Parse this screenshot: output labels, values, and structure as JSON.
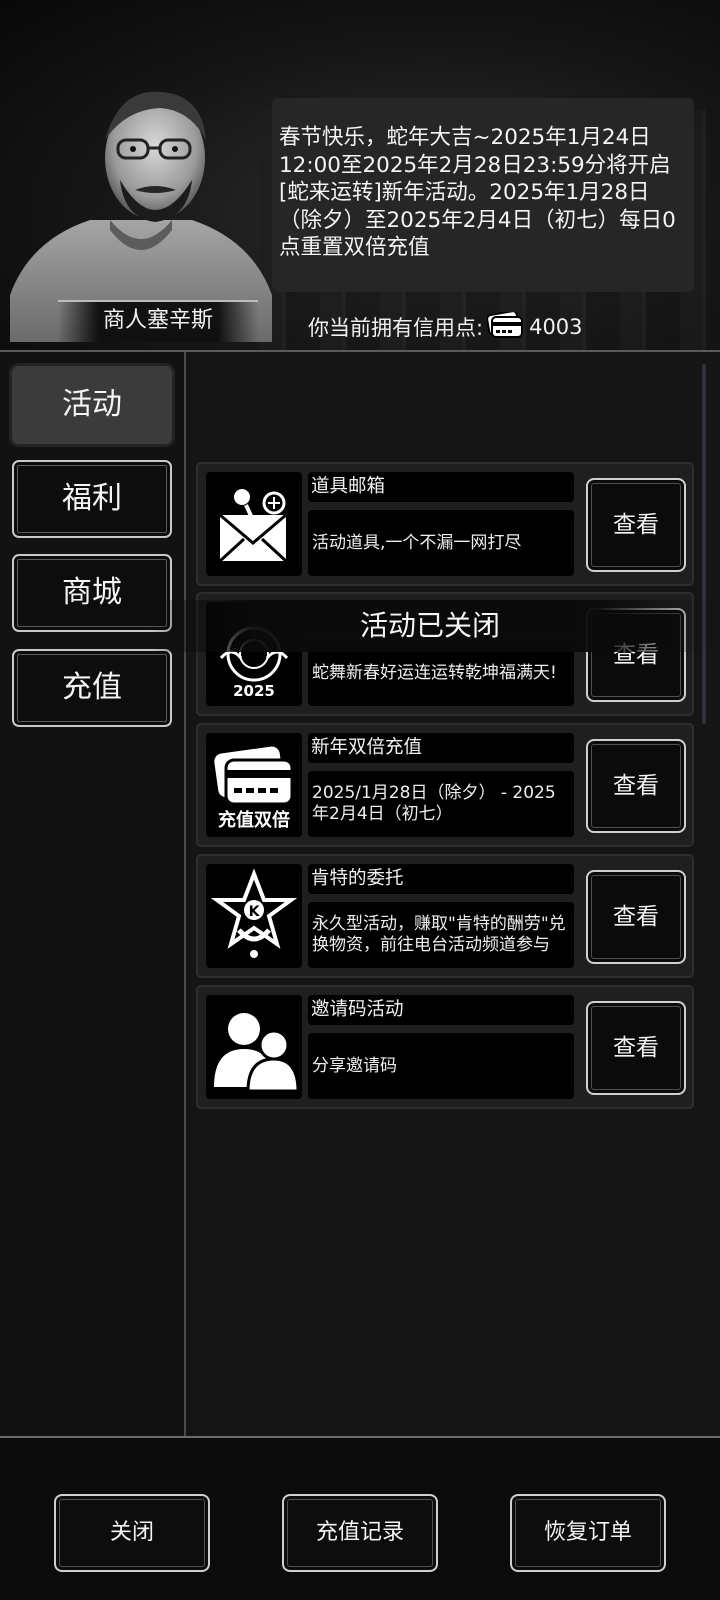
{
  "npc": {
    "name": "商人塞辛斯",
    "message": "春节快乐，蛇年大吉~2025年1月24日12:00至2025年2月28日23:59分将开启[蛇来运转]新年活动。2025年1月28日（除夕）至2025年2月4日（初七）每日0点重置双倍充值"
  },
  "credit": {
    "label": "你当前拥有信用点:",
    "value": "4003"
  },
  "sidebar": {
    "tabs": [
      {
        "label": "活动",
        "active": true
      },
      {
        "label": "福利",
        "active": false
      },
      {
        "label": "商城",
        "active": false
      },
      {
        "label": "充值",
        "active": false
      }
    ]
  },
  "activities": [
    {
      "title": "道具邮箱",
      "desc": "活动道具,一个不漏一网打尽",
      "icon": "mail-pin-icon",
      "button": "查看"
    },
    {
      "title": "",
      "desc": "蛇舞新春好运连运转乾坤福满天!",
      "icon": "snake-emblem-icon",
      "icon_text": "2025",
      "button": "查看"
    },
    {
      "title": "新年双倍充值",
      "desc": "2025/1月28日（除夕） - 2025年2月4日（初七）",
      "icon": "credit-card-icon",
      "icon_text": "充值双倍",
      "button": "查看"
    },
    {
      "title": "肯特的委托",
      "desc": "永久型活动，赚取\"肯特的酬劳\"兑换物资，前往电台活动频道参与",
      "icon": "k-star-emblem-icon",
      "icon_text": "K",
      "button": "查看"
    },
    {
      "title": "邀请码活动",
      "desc": "分享邀请码",
      "icon": "users-icon",
      "button": "查看"
    }
  ],
  "overlay_text": "活动已关闭",
  "footer": {
    "close": "关闭",
    "history": "充值记录",
    "restore": "恢复订单"
  }
}
